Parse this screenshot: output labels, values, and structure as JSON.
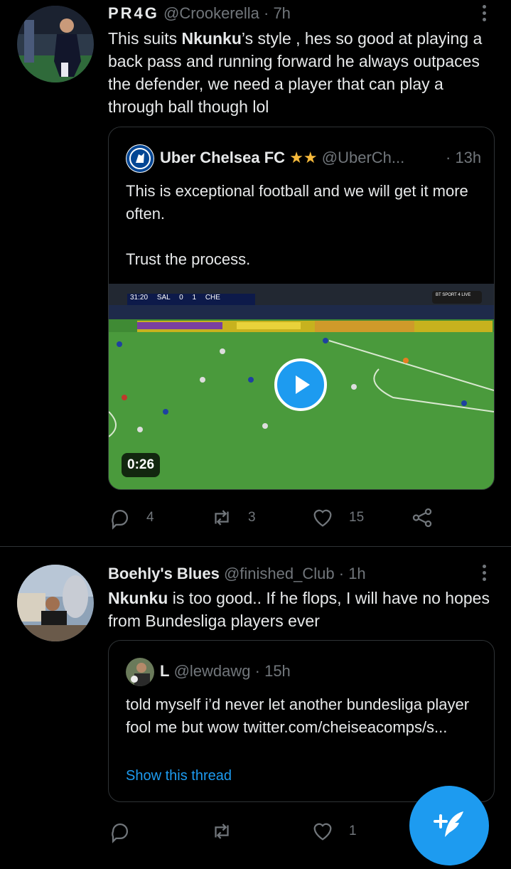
{
  "tweets": [
    {
      "display_name": "PR4G",
      "handle": "@Crookerella",
      "time": "· 7h",
      "text_bold": "Nkunku",
      "text_pre": "This suits ",
      "text_post": "’s style , hes so good at playing a back pass and running forward he always outpaces the defender, we need a player that can play a through ball though lol",
      "quote": {
        "display_name": "Uber Chelsea FC",
        "badges": "★★",
        "handle": "@UberCh...",
        "time": "· 13h",
        "text_line1": "This is exceptional football and we will get it more often.",
        "text_line2": "Trust the process.",
        "video": {
          "duration": "0:26",
          "score_time": "31:20",
          "team_home": "SAL",
          "score_home": "0",
          "score_away": "1",
          "team_away": "CHE",
          "broadcaster": "BT SPORT 4 LIVE"
        }
      },
      "stats": {
        "replies": "4",
        "retweets": "3",
        "likes": "15"
      }
    },
    {
      "display_name": "Boehly's Blues",
      "handle": "@finished_Club",
      "time": "· 1h",
      "text_bold": "Nkunku",
      "text_post": " is too good.. If he flops, I will have no hopes from Bundesliga players ever",
      "quote": {
        "display_name": "L",
        "handle": "@lewdawg",
        "time": "· 15h",
        "text": "told myself i’d never let another bundesliga player fool me but wow twitter.com/cheiseacomps/s...",
        "show_thread": "Show this thread"
      },
      "stats": {
        "replies": "",
        "retweets": "",
        "likes": "1"
      }
    }
  ],
  "colors": {
    "accent": "#1d9bf0",
    "muted": "#71767b",
    "text": "#e7e9ea",
    "background": "#000000"
  }
}
